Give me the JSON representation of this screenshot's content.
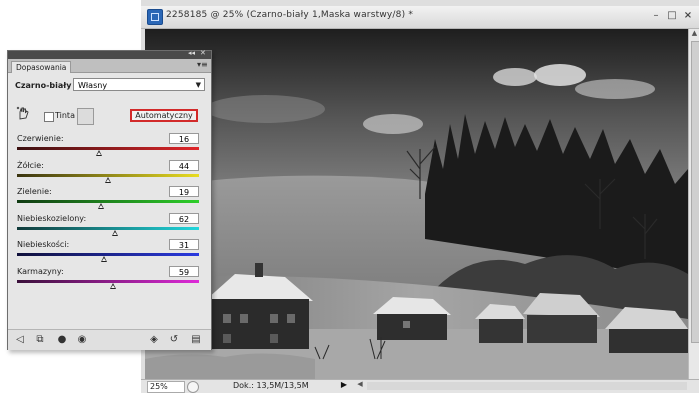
{
  "document": {
    "title": "2258185 @ 25% (Czarno-biały 1,Maska warstwy/8) *",
    "window_buttons": {
      "minimize": "–",
      "maximize": "□",
      "close": "×"
    },
    "status": {
      "zoom": "25%",
      "doc_info": "Dok.: 13,5M/13,5M"
    }
  },
  "panel": {
    "tab": "Dopasowania",
    "preset_label": "Czarno-biały",
    "preset_value": "Własny",
    "tint_label": "Tinta",
    "tint_checked": false,
    "auto_button": "Automatyczny",
    "sliders": [
      {
        "label": "Czerwienie:",
        "value": "16",
        "fraction": 0.45
      },
      {
        "label": "Żółcie:",
        "value": "44",
        "fraction": 0.5
      },
      {
        "label": "Zielenie:",
        "value": "19",
        "fraction": 0.46
      },
      {
        "label": "Niebieskozielony:",
        "value": "62",
        "fraction": 0.54
      },
      {
        "label": "Niebieskości:",
        "value": "31",
        "fraction": 0.48
      },
      {
        "label": "Karmazyny:",
        "value": "59",
        "fraction": 0.53
      }
    ]
  },
  "colors": {
    "highlight_border": "#d22a2a",
    "red_gradient": [
      "#3a1010",
      "#e0262a"
    ],
    "yellow_gradient": [
      "#3a3410",
      "#e8dc22"
    ],
    "green_gradient": [
      "#103a12",
      "#2ecf2a"
    ],
    "cyan_gradient": [
      "#103a3a",
      "#22d6dc"
    ],
    "blue_gradient": [
      "#10103a",
      "#2a3ae0"
    ],
    "magenta_gradient": [
      "#3a103a",
      "#de2ad8"
    ]
  },
  "icons": {
    "footer": [
      "back-icon",
      "layer-view-icon",
      "visibility-eye-icon",
      "view-previous-icon",
      "clip-layer-icon",
      "reset-icon",
      "delete-icon"
    ]
  }
}
